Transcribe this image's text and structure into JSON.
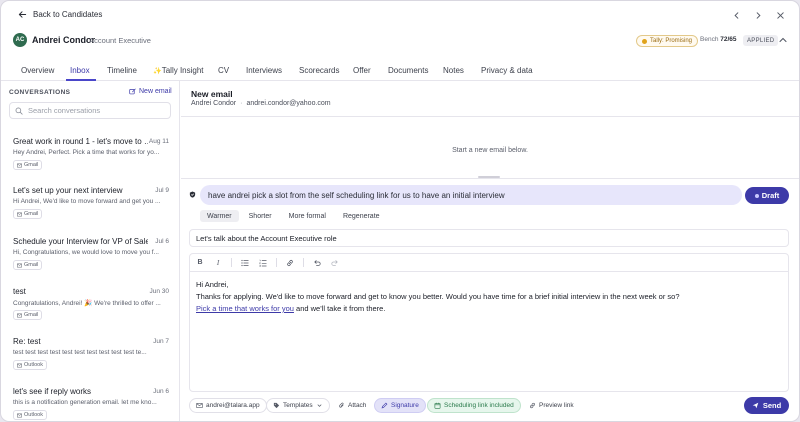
{
  "topbar": {
    "back_label": "Back to Candidates"
  },
  "candidate": {
    "initials": "AC",
    "name": "Andrei Condor",
    "role": "· Account Executive",
    "tally_pill": "Tally: Promising",
    "bench_label": "Bench",
    "bench_value": "72/65",
    "status": "APPLIED"
  },
  "tabs": [
    "Overview",
    "Inbox",
    "Timeline",
    "Tally Insight",
    "CV",
    "Interviews",
    "Scorecards",
    "Offer",
    "Documents",
    "Notes",
    "Privacy & data"
  ],
  "active_tab": "Inbox",
  "sidebar": {
    "title": "CONVERSATIONS",
    "new_email": "New email",
    "search_placeholder": "Search conversations",
    "conversations": [
      {
        "subject": "Great work in round 1 - let's move to …",
        "date": "Aug 11",
        "preview": "Hey Andrei, Perfect. Pick a time that works for yo...",
        "source": "Gmail"
      },
      {
        "subject": "Let's set up your next interview",
        "date": "Jul 9",
        "preview": "Hi Andrei, We'd like to move forward and get you ...",
        "source": "Gmail"
      },
      {
        "subject": "Schedule your Interview for VP of Sales",
        "date": "Jul 6",
        "preview": "Hi, Congratulations, we would love to move you f...",
        "source": "Gmail"
      },
      {
        "subject": "test",
        "date": "Jun 30",
        "preview": "Congratulations, Andrei! 🎉 We're thrilled to offer ...",
        "source": "Gmail"
      },
      {
        "subject": "Re: test",
        "date": "Jun 7",
        "preview": "test test test test test test test test test test te...",
        "source": "Outlook"
      },
      {
        "subject": "let's see if reply works",
        "date": "Jun 6",
        "preview": "this is a notification generation email. let me kno...",
        "source": "Outlook"
      }
    ]
  },
  "compose": {
    "title": "New email",
    "to_name": "Andrei Condor",
    "to_sep": "·",
    "to_email": "andrei.condor@yahoo.com",
    "empty_message": "Start a new email below.",
    "ai_prompt": "have andrei pick a slot from the self scheduling link for us to have an initial interview",
    "draft_label": "Draft",
    "chips": [
      "Warmer",
      "Shorter",
      "More formal",
      "Regenerate"
    ],
    "subject": "Let's talk about the Account Executive role",
    "body_greeting": "Hi Andrei,",
    "body_line1": "Thanks for applying. We'd like to move forward and get to know you better. Would you have time for a brief initial interview in the next week or so?",
    "body_link": "Pick a time that works for you",
    "body_line2_rest": " and we'll take it from there.",
    "from_account": "andrei@talara.app",
    "templates": "Templates",
    "attach": "Attach",
    "signature": "Signature",
    "scheduling": "Scheduling link included",
    "preview_link": "Preview link",
    "send": "Send"
  }
}
